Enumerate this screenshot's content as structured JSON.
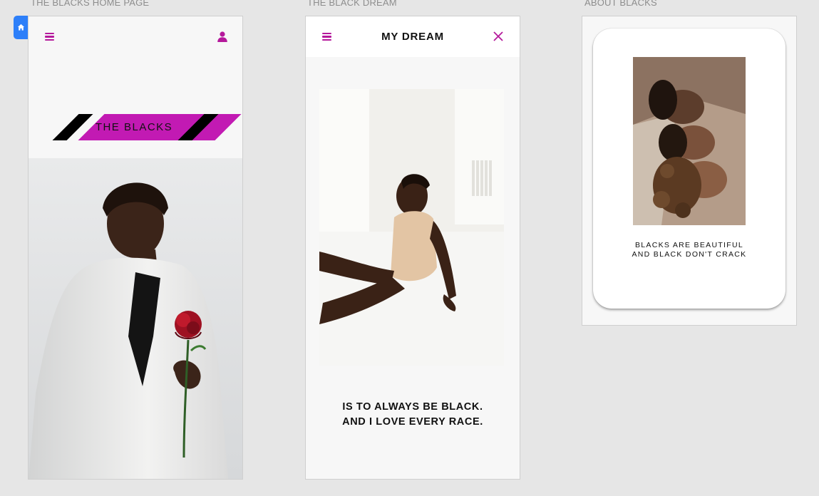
{
  "artboards": {
    "home": {
      "label": "THE BLACKS HOME PAGE",
      "banner_text": "THE BLACKS"
    },
    "dream": {
      "label": "THE BLACK DREAM",
      "title": "MY DREAM",
      "quote_line1": "IS TO ALWAYS BE BLACK.",
      "quote_line2": "AND I LOVE EVERY RACE."
    },
    "about": {
      "label": "ABOUT BLACKS",
      "caption_line1": "BLACKS ARE BEAUTIFUL",
      "caption_line2": "AND BLACK DON'T CRACK"
    }
  },
  "icons": {
    "home_tab": "home-icon",
    "menu": "hamburger-menu-icon",
    "user": "user-icon",
    "close": "close-icon"
  },
  "colors": {
    "accent": "#c21ab3",
    "menu_icon": "#b5199b",
    "canvas": "#e6e6e6",
    "artboard_bg": "#f7f7f7",
    "home_tab": "#2d7ff9"
  }
}
